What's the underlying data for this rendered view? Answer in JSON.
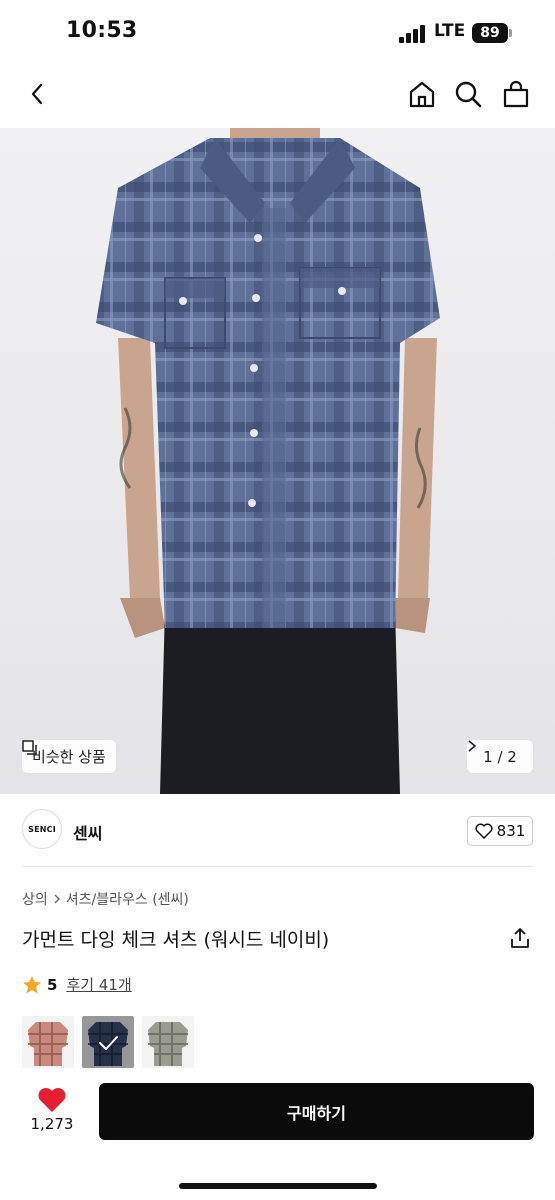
{
  "status_bar": {
    "time": "10:53",
    "network": "LTE",
    "battery": "89"
  },
  "nav": {
    "icons": [
      "back-icon",
      "home-icon",
      "search-icon",
      "shopping-bag-icon"
    ]
  },
  "hero": {
    "similar_label": "비슷한 상품",
    "page_indicator": "1 / 2"
  },
  "shop": {
    "logo_text": "SENCI",
    "name": "센씨",
    "favorite_count": "831"
  },
  "product": {
    "breadcrumb": [
      "상의",
      "셔츠/블라우스 (센씨)"
    ],
    "title": "가먼트 다잉 체크 셔츠 (워시드 네이비)",
    "rating": "5",
    "review_link": "후기 41개",
    "variants": [
      {
        "color": "#c98a7d",
        "selected": false
      },
      {
        "color": "#3b4a6e",
        "selected": true
      },
      {
        "color": "#9a9c8f",
        "selected": false
      }
    ]
  },
  "bottom_bar": {
    "like_count": "1,273",
    "buy_label": "구매하기"
  },
  "colors": {
    "accent_star": "#f5a623",
    "like_heart": "#e5202e",
    "buy_button": "#0b0b0b",
    "shirt": "#5a6c97"
  }
}
